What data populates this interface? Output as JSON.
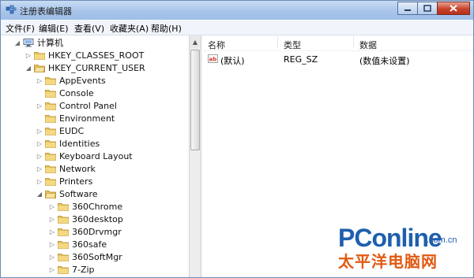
{
  "window": {
    "title": "注册表编辑器"
  },
  "menu": [
    "文件(F)",
    "编辑(E)",
    "查看(V)",
    "收藏夹(A)",
    "帮助(H)"
  ],
  "tree": {
    "root": "计算机",
    "hive1": "HKEY_CLASSES_ROOT",
    "hive2": "HKEY_CURRENT_USER",
    "hkcu_children": [
      "AppEvents",
      "Console",
      "Control Panel",
      "Environment",
      "EUDC",
      "Identities",
      "Keyboard Layout",
      "Network",
      "Printers",
      "Software"
    ],
    "software_children": [
      "360Chrome",
      "360desktop",
      "360Drvmgr",
      "360safe",
      "360SoftMgr",
      "7-Zip"
    ]
  },
  "values_pane": {
    "columns": {
      "name": "名称",
      "type": "类型",
      "data": "数据"
    },
    "row": {
      "name": "(默认)",
      "type": "REG_SZ",
      "data": "(数值未设置)"
    }
  },
  "watermark": {
    "brand": "PConline",
    "domain": ".com.cn",
    "cn": "太平洋电脑网"
  }
}
